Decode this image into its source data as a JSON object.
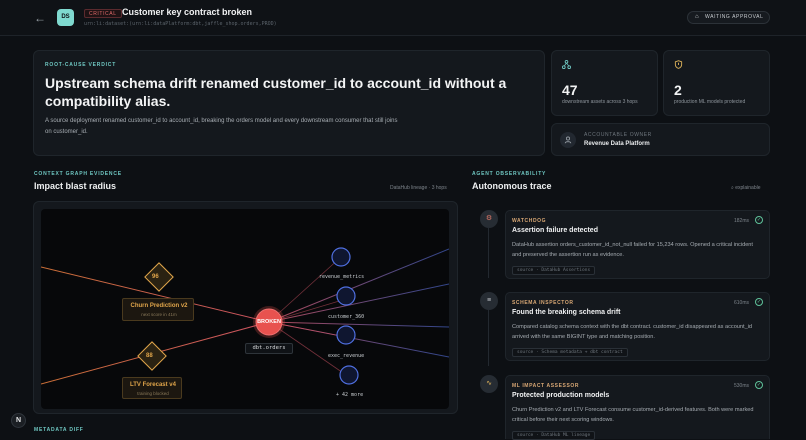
{
  "header": {
    "back_icon": "arrow-left-icon",
    "logo_text": "DS",
    "severity": "CRITICAL",
    "title": "Customer key contract broken",
    "urn": "urn:li:dataset:(urn:li:dataPlatform:dbt,jaffle_shop.orders,PROD)",
    "status": "WAITING APPROVAL"
  },
  "verdict": {
    "label": "ROOT-CAUSE VERDICT",
    "headline": "Upstream schema drift renamed customer_id to account_id without a compatibility alias.",
    "body": "A source deployment renamed customer_id to account_id, breaking the orders model and every downstream consumer that still joins on customer_id."
  },
  "stats": [
    {
      "icon": "network-icon",
      "value": "47",
      "label": "downstream assets across 3 hops"
    },
    {
      "icon": "shield-icon",
      "value": "2",
      "label": "production ML models protected"
    }
  ],
  "owner": {
    "label": "ACCOUNTABLE OWNER",
    "value": "Revenue Data Platform"
  },
  "graph_section": {
    "kicker": "CONTEXT GRAPH EVIDENCE",
    "title": "Impact blast radius",
    "meta": "DataHub lineage · 3 hops",
    "broken_label": "BROKEN",
    "center_label": "dbt.orders",
    "models": [
      {
        "score": "96",
        "name": "Churn Prediction v2",
        "sub": "next score in 41m"
      },
      {
        "score": "88",
        "name": "LTV Forecast v4",
        "sub": "training blocked"
      }
    ],
    "assets": [
      "revenue_metrics",
      "customer_360",
      "exec_revenue",
      "+ 42 more"
    ]
  },
  "trace_section": {
    "kicker": "AGENT OBSERVABILITY",
    "title": "Autonomous trace",
    "meta": "explainable",
    "items": [
      {
        "icon": "robot-icon",
        "kicker": "WATCHDOG",
        "ms": "182ms",
        "title": "Assertion failure detected",
        "body": "DataHub assertion orders_customer_id_not_null failed for 15,234 rows. Opened a critical incident and preserved the assertion run as evidence.",
        "source": "source · DataHub Assertions"
      },
      {
        "icon": "database-icon",
        "kicker": "SCHEMA INSPECTOR",
        "ms": "610ms",
        "title": "Found the breaking schema drift",
        "body": "Compared catalog schema context with the dbt contract. customer_id disappeared as account_id arrived with the same BIGINT type and matching position.",
        "source": "source · Schema metadata + dbt contract"
      },
      {
        "icon": "pulse-icon",
        "kicker": "ML IMPACT ASSESSOR",
        "ms": "530ms",
        "title": "Protected production models",
        "body": "Churn Prediction v2 and LTV Forecast consume customer_id-derived features. Both were marked critical before their next scoring windows.",
        "source": "source · DataHub ML lineage"
      }
    ]
  },
  "diff_section": {
    "kicker": "METADATA DIFF"
  },
  "corner_badge": "N",
  "colors": {
    "accent": "#6fc7c2",
    "critical": "#e36a6a",
    "warning": "#d8a774",
    "ok": "#5fc29a",
    "asset": "#4f6fe0"
  }
}
